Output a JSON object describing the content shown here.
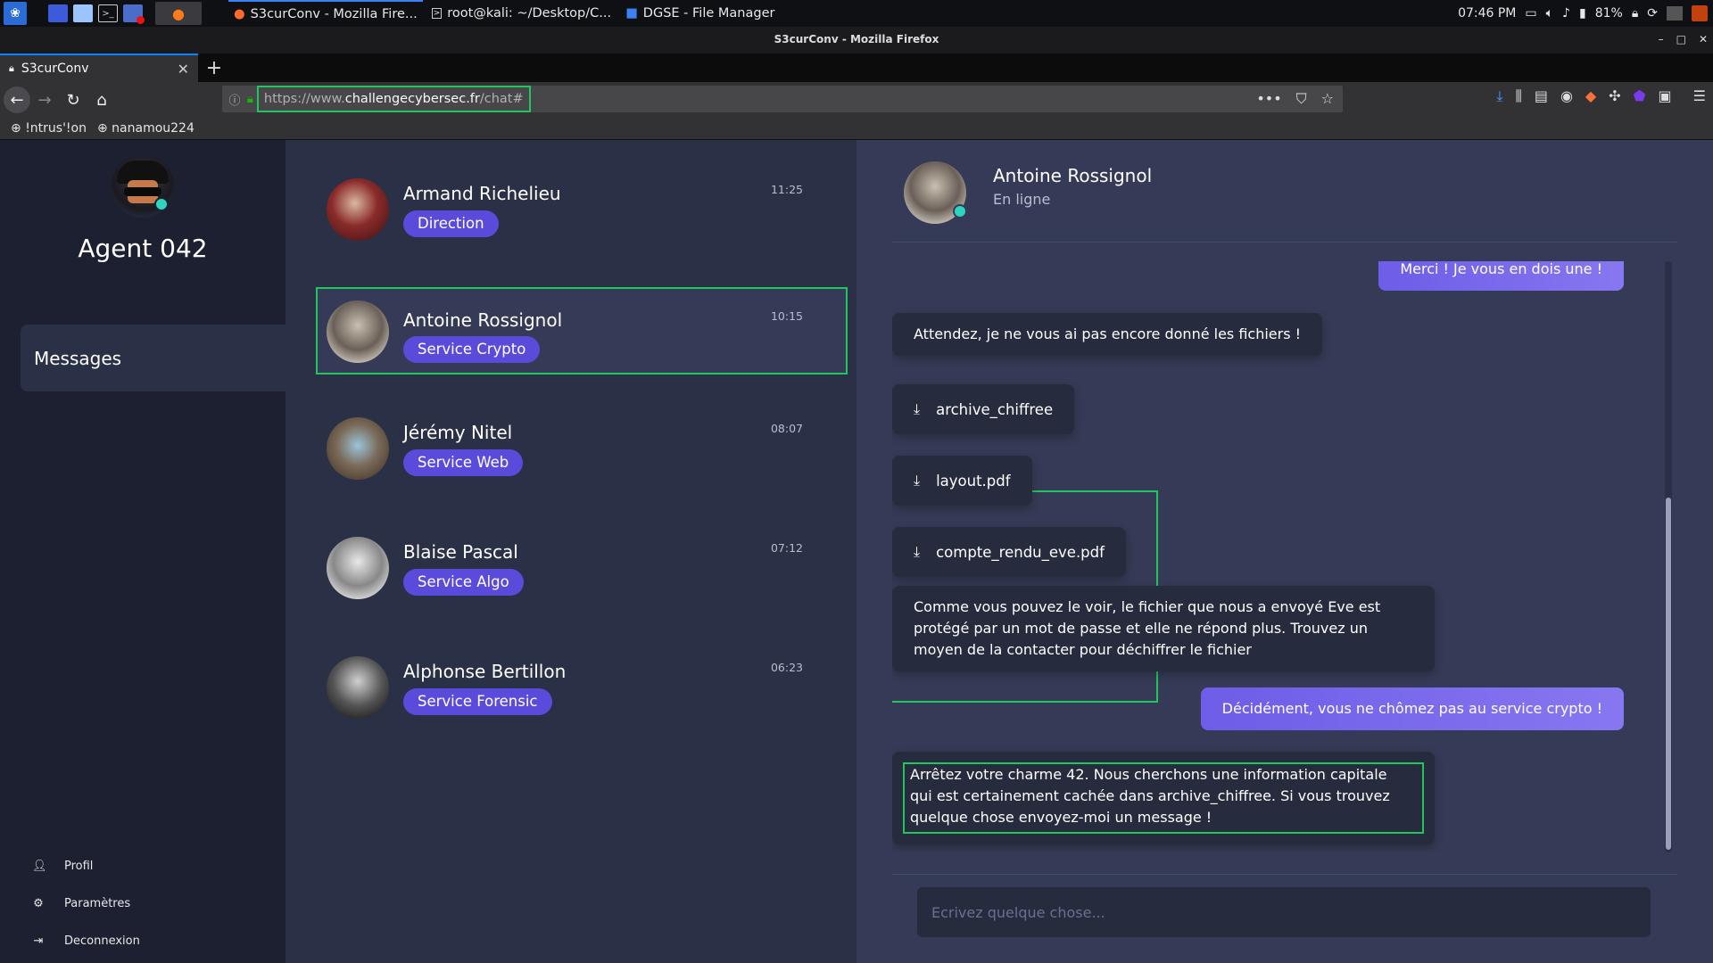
{
  "taskbar": {
    "tasks": [
      {
        "label": "S3curConv - Mozilla Fire...",
        "icon": "firefox-icon"
      },
      {
        "label": "root@kali: ~/Desktop/C...",
        "icon": "terminal-icon"
      },
      {
        "label": "DGSE - File Manager",
        "icon": "folder-icon"
      }
    ],
    "clock": "07:46 PM",
    "battery": "81%"
  },
  "window": {
    "title": "S3curConv - Mozilla Firefox"
  },
  "browser": {
    "tab_title": "S3curConv",
    "url_prefix": "https://www.",
    "url_domain": "challengecybersec.fr",
    "url_path": "/chat#",
    "bookmarks": [
      "!ntrus'!on",
      "nanamou224"
    ]
  },
  "sidebar": {
    "agent_name": "Agent 042",
    "nav_messages": "Messages",
    "links": [
      "Profil",
      "Paramètres",
      "Deconnexion"
    ]
  },
  "contacts": [
    {
      "name": "Armand Richelieu",
      "badge": "Direction",
      "time": "11:25"
    },
    {
      "name": "Antoine Rossignol",
      "badge": "Service Crypto",
      "time": "10:15"
    },
    {
      "name": "Jérémy Nitel",
      "badge": "Service Web",
      "time": "08:07"
    },
    {
      "name": "Blaise Pascal",
      "badge": "Service Algo",
      "time": "07:12"
    },
    {
      "name": "Alphonse Bertillon",
      "badge": "Service Forensic",
      "time": "06:23"
    }
  ],
  "chat": {
    "name": "Antoine Rossignol",
    "status": "En ligne",
    "messages": [
      "Merci ! Je vous en dois une !",
      "Attendez, je ne vous ai pas encore donné les fichiers !",
      "Comme vous pouvez le voir, le fichier que nous a envoyé Eve est protégé par un mot de passe et elle ne répond plus. Trouvez un moyen de la contacter pour déchiffrer le fichier",
      "Décidément, vous ne chômez pas au service crypto !",
      "Arrêtez votre charme 42. Nous cherchons une information capitale qui est certainement cachée dans archive_chiffree. Si vous trouvez quelque chose envoyez-moi un message !"
    ],
    "files": [
      "archive_chiffree",
      "layout.pdf",
      "compte_rendu_eve.pdf"
    ],
    "composer_placeholder": "Ecrivez quelque chose..."
  },
  "colors": {
    "accent": "#5b4bdb",
    "highlight": "#22c55e",
    "online": "#2dd4bf"
  }
}
